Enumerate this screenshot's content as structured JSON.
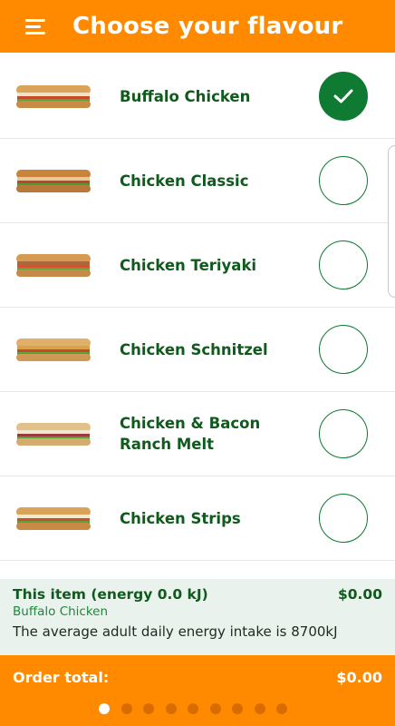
{
  "header": {
    "title": "Choose your flavour",
    "menu_icon": "hamburger-menu-icon"
  },
  "flavours": [
    {
      "label": "Buffalo Chicken",
      "selected": true
    },
    {
      "label": "Chicken Classic",
      "selected": false
    },
    {
      "label": "Chicken Teriyaki",
      "selected": false
    },
    {
      "label": "Chicken Schnitzel",
      "selected": false
    },
    {
      "label": "Chicken & Bacon Ranch Melt",
      "selected": false
    },
    {
      "label": "Chicken Strips",
      "selected": false
    }
  ],
  "summary": {
    "item_label": "This item (energy 0.0 kJ)",
    "item_price": "$0.00",
    "item_name": "Buffalo Chicken",
    "energy_note": "The average adult daily energy intake is 8700kJ"
  },
  "footer": {
    "total_label": "Order total:",
    "total_value": "$0.00",
    "page_count": 9,
    "active_page": 1
  },
  "colors": {
    "brand_orange": "#ff8a00",
    "brand_green": "#0f7a32",
    "text_green": "#0f5a1c"
  }
}
